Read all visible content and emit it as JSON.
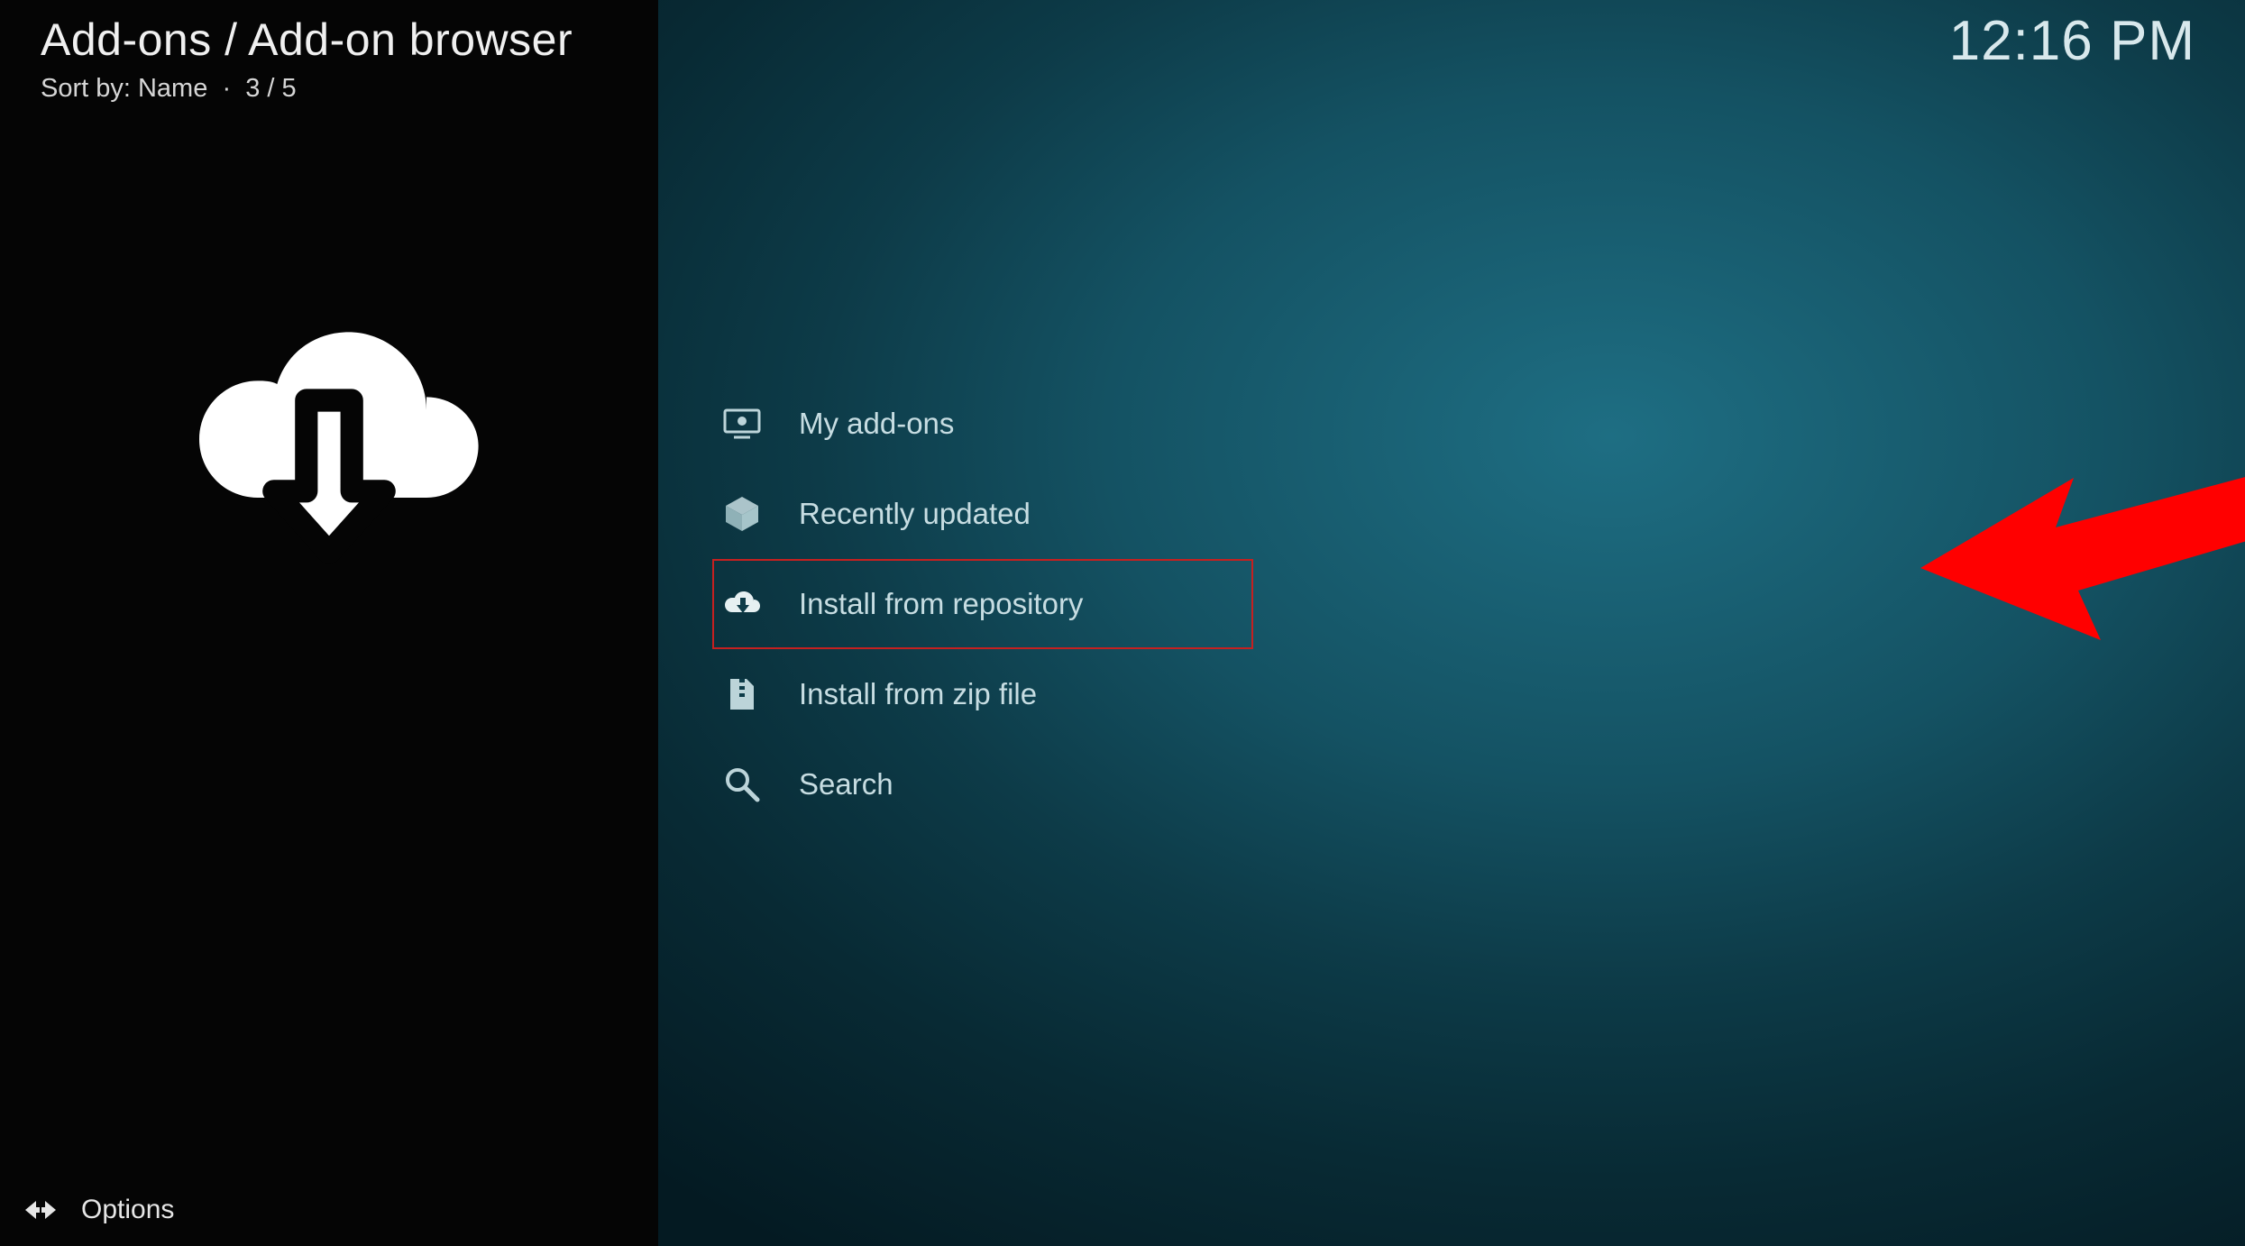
{
  "header": {
    "breadcrumb": "Add-ons / Add-on browser",
    "sort_label": "Sort by: Name",
    "position": "3 / 5",
    "clock": "12:16 PM"
  },
  "sidebar": {
    "big_icon": "cloud-download-icon",
    "options_label": "Options"
  },
  "menu": {
    "items": [
      {
        "icon": "monitor-icon",
        "label": "My add-ons",
        "highlighted": false
      },
      {
        "icon": "open-box-icon",
        "label": "Recently updated",
        "highlighted": false
      },
      {
        "icon": "cloud-install-icon",
        "label": "Install from repository",
        "highlighted": true
      },
      {
        "icon": "zip-file-icon",
        "label": "Install from zip file",
        "highlighted": false
      },
      {
        "icon": "search-icon",
        "label": "Search",
        "highlighted": false
      }
    ]
  },
  "annotation": {
    "arrow_color": "#ff0000"
  }
}
